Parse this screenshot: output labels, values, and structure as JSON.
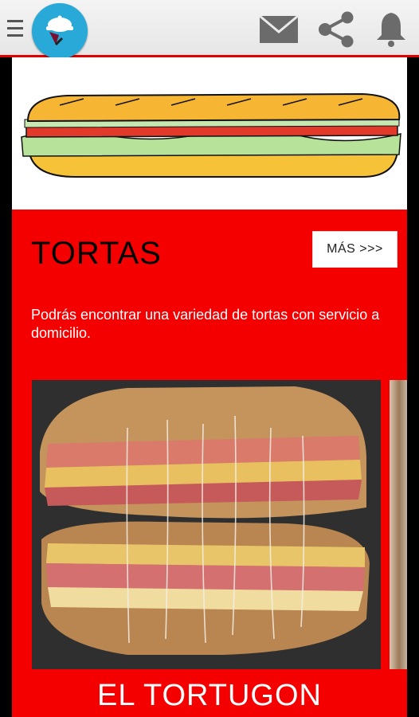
{
  "section": {
    "title": "TORTAS",
    "more_label": "MÁS >>>",
    "description": "Podrás encontrar una variedad de tortas con servicio a domicilio."
  },
  "card": {
    "title": "EL TORTUGON"
  },
  "colors": {
    "accent": "#f50000",
    "logo": "#29a9d8",
    "icons": "#6b6b6b"
  },
  "icons": [
    "menu-icon",
    "logo",
    "mail-icon",
    "share-icon",
    "bell-icon"
  ]
}
